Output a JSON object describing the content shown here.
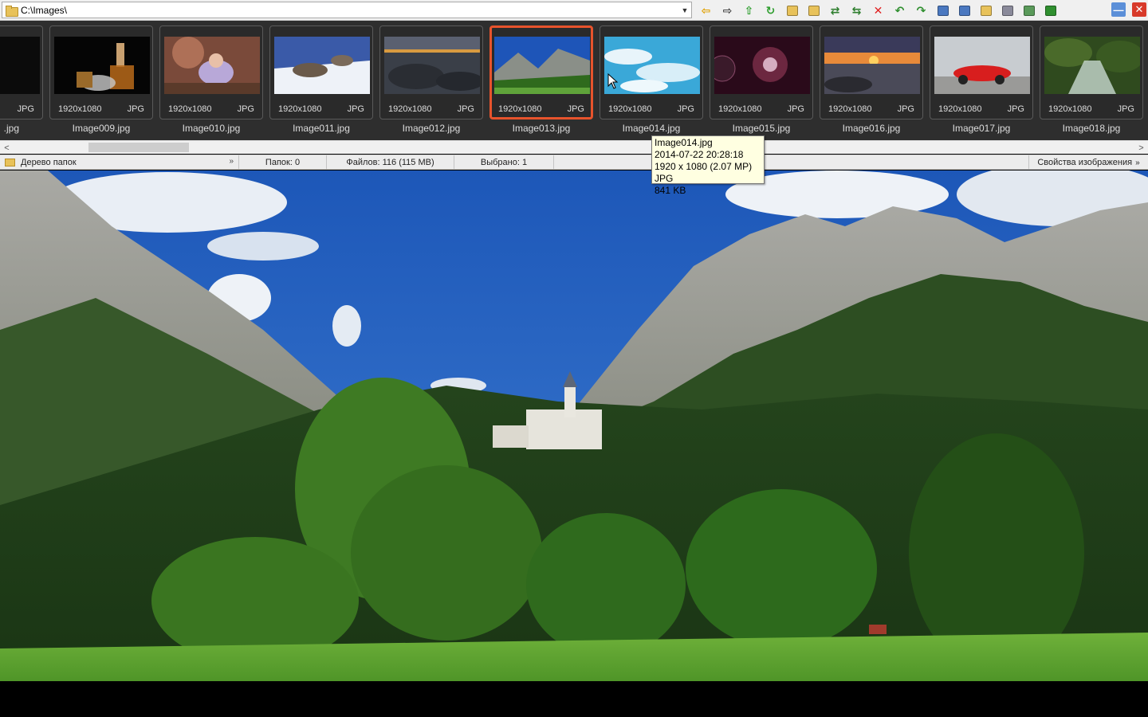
{
  "window": {
    "path": "C:\\Images\\"
  },
  "toolbar": {
    "icons": [
      {
        "name": "back-icon",
        "glyph": "⇦",
        "color": "#e0a000"
      },
      {
        "name": "forward-icon",
        "glyph": "⇨",
        "color": "#444444"
      },
      {
        "name": "folder-up-icon",
        "glyph": "⇧",
        "color": "#2f9e2f"
      },
      {
        "name": "refresh-icon",
        "glyph": "↻",
        "color": "#2f9e2f"
      },
      {
        "name": "new-folder-icon",
        "glyph": "",
        "color": "#e8c25a"
      },
      {
        "name": "folder-icon",
        "glyph": "",
        "color": "#e8c25a"
      },
      {
        "name": "copy-to-icon",
        "glyph": "⇄",
        "color": "#2f7f2f"
      },
      {
        "name": "move-to-icon",
        "glyph": "⇆",
        "color": "#2f7f2f"
      },
      {
        "name": "delete-icon",
        "glyph": "✕",
        "color": "#e02020"
      },
      {
        "name": "rotate-left-icon",
        "glyph": "↶",
        "color": "#2f8f2f"
      },
      {
        "name": "rotate-right-icon",
        "glyph": "↷",
        "color": "#2f8f2f"
      },
      {
        "name": "compare-icon",
        "glyph": "",
        "color": "#4a78c0"
      },
      {
        "name": "slideshow-icon",
        "glyph": "",
        "color": "#4a78c0"
      },
      {
        "name": "open-icon",
        "glyph": "",
        "color": "#e8c25a"
      },
      {
        "name": "print-icon",
        "glyph": "",
        "color": "#8a8a9a"
      },
      {
        "name": "edit-icon",
        "glyph": "",
        "color": "#5a9a5a"
      },
      {
        "name": "exit-icon",
        "glyph": "",
        "color": "#2f8f2f"
      }
    ],
    "minimize_glyph": "—",
    "close_glyph": "✕",
    "minimize_color": "#5b8fd8",
    "close_color": "#d83a2a"
  },
  "thumbnails": [
    {
      "name": ".jpg",
      "resolution": "",
      "type": "JPG",
      "art": "fruit"
    },
    {
      "name": "Image009.jpg",
      "resolution": "1920x1080",
      "type": "JPG",
      "art": "whisky"
    },
    {
      "name": "Image010.jpg",
      "resolution": "1920x1080",
      "type": "JPG",
      "art": "child"
    },
    {
      "name": "Image011.jpg",
      "resolution": "1920x1080",
      "type": "JPG",
      "art": "wolves"
    },
    {
      "name": "Image012.jpg",
      "resolution": "1920x1080",
      "type": "JPG",
      "art": "rocks"
    },
    {
      "name": "Image013.jpg",
      "resolution": "1920x1080",
      "type": "JPG",
      "art": "mountains",
      "selected": true
    },
    {
      "name": "Image014.jpg",
      "resolution": "1920x1080",
      "type": "JPG",
      "art": "sky"
    },
    {
      "name": "Image015.jpg",
      "resolution": "1920x1080",
      "type": "JPG",
      "art": "space"
    },
    {
      "name": "Image016.jpg",
      "resolution": "1920x1080",
      "type": "JPG",
      "art": "sunset"
    },
    {
      "name": "Image017.jpg",
      "resolution": "1920x1080",
      "type": "JPG",
      "art": "car"
    },
    {
      "name": "Image018.jpg",
      "resolution": "1920x1080",
      "type": "JPG",
      "art": "stream"
    }
  ],
  "scrollbar": {
    "left_arrow": "<",
    "right_arrow": ">"
  },
  "statusbar": {
    "folder_tree": "Дерево папок",
    "folder_tree_arrow": "»",
    "folders": "Папок: 0",
    "files": "Файлов: 116 (115 MB)",
    "selected": "Выбрано: 1",
    "image_properties": "Свойства изображения",
    "image_properties_arrow": "»"
  },
  "tooltip": {
    "filename": "Image014.jpg",
    "datetime": "2014-07-22 20:28:18",
    "dimensions": "1920 x 1080 (2.07 MP)  JPG",
    "size": "841 KB"
  },
  "path_dropdown_glyph": "▼"
}
